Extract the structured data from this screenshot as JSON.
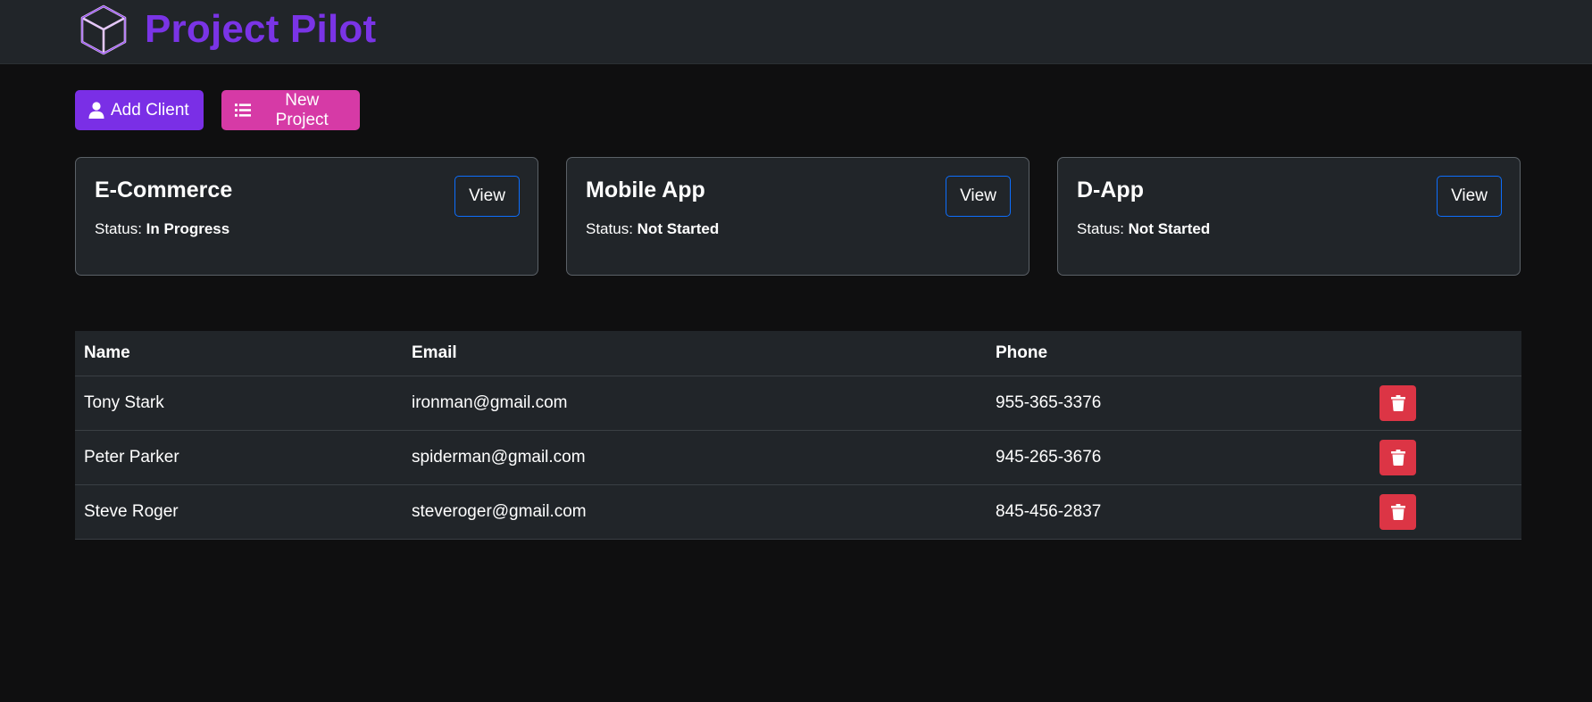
{
  "brand": {
    "title": "Project Pilot",
    "logo_icon": "cube-icon",
    "color": "#7a34e6"
  },
  "actions": {
    "add_client": {
      "label": "Add Client",
      "icon": "user-icon",
      "color": "#7a2fe6"
    },
    "new_project": {
      "label": "New Project",
      "icon": "list-icon",
      "color": "#d63aa6"
    }
  },
  "projects": [
    {
      "name": "E-Commerce",
      "status_label": "Status:",
      "status": "In Progress",
      "view_label": "View"
    },
    {
      "name": "Mobile App",
      "status_label": "Status:",
      "status": "Not Started",
      "view_label": "View"
    },
    {
      "name": "D-App",
      "status_label": "Status:",
      "status": "Not Started",
      "view_label": "View"
    }
  ],
  "clients_table": {
    "headers": {
      "name": "Name",
      "email": "Email",
      "phone": "Phone"
    },
    "rows": [
      {
        "name": "Tony Stark",
        "email": "ironman@gmail.com",
        "phone": "955-365-3376"
      },
      {
        "name": "Peter Parker",
        "email": "spiderman@gmail.com",
        "phone": "945-265-3676"
      },
      {
        "name": "Steve Roger",
        "email": "steveroger@gmail.com",
        "phone": "845-456-2837"
      }
    ],
    "delete_icon": "trash-icon",
    "delete_color": "#dc3545"
  }
}
